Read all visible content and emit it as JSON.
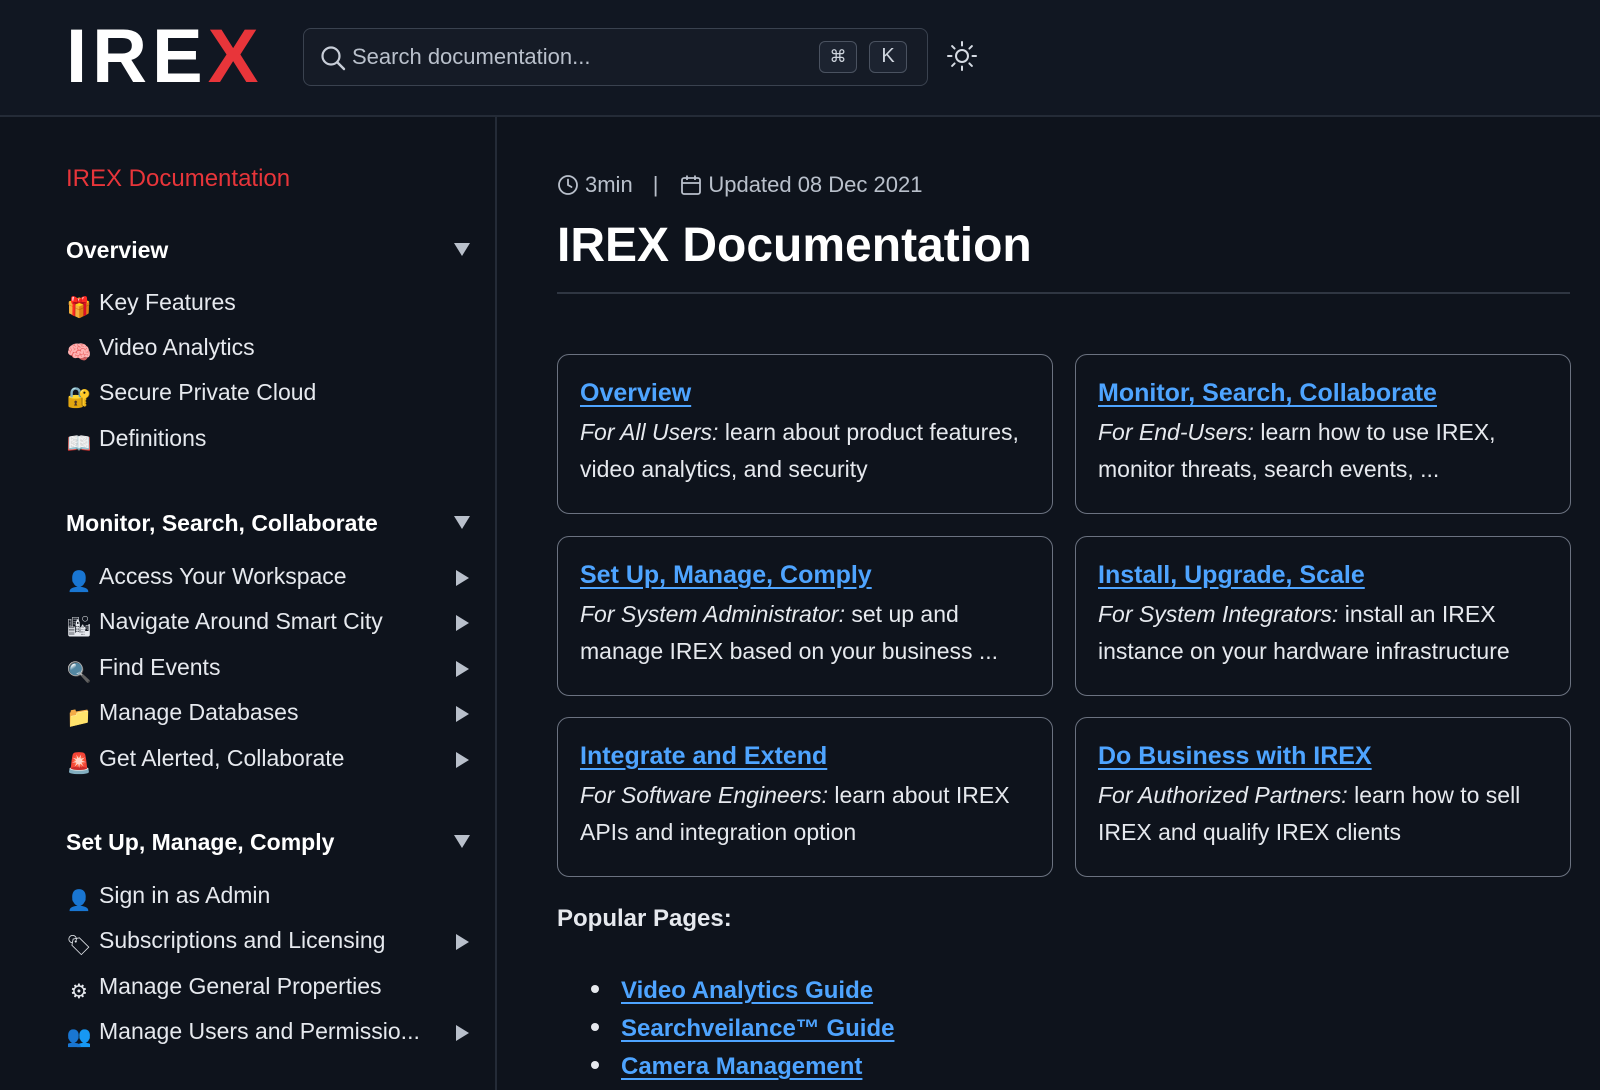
{
  "header": {
    "logo_text": "IRE",
    "logo_accent": "X",
    "search_placeholder": "Search documentation...",
    "shortcut_cmd": "⌘",
    "shortcut_key": "K",
    "theme_icon": "sun-icon"
  },
  "sidebar": {
    "title": "IREX Documentation",
    "sections": [
      {
        "label": "Overview",
        "items": [
          {
            "icon": "🎁",
            "label": "Key Features"
          },
          {
            "icon": "🧠",
            "label": "Video Analytics"
          },
          {
            "icon": "🔐",
            "label": "Secure Private Cloud"
          },
          {
            "icon": "📖",
            "label": "Definitions"
          }
        ]
      },
      {
        "label": "Monitor, Search, Collaborate",
        "items": [
          {
            "icon": "👤",
            "label": "Access Your Workspace"
          },
          {
            "icon": "🏙",
            "label": "Navigate Around Smart City"
          },
          {
            "icon": "🔍",
            "label": "Find Events"
          },
          {
            "icon": "📁",
            "label": "Manage Databases"
          },
          {
            "icon": "🚨",
            "label": "Get Alerted, Collaborate"
          }
        ]
      },
      {
        "label": "Set Up, Manage, Comply",
        "items": [
          {
            "icon": "👤",
            "label": "Sign in as Admin"
          },
          {
            "icon": "🏷",
            "label": "Subscriptions and Licensing"
          },
          {
            "icon": "⚙",
            "label": "Manage General Properties"
          },
          {
            "icon": "👥",
            "label": "Manage Users and Permissio..."
          }
        ]
      }
    ]
  },
  "main": {
    "read_time": "3min",
    "separator": "|",
    "updated": "Updated 08 Dec 2021",
    "title": "IREX Documentation",
    "cards": [
      {
        "title": "Overview",
        "audience": "For All Users:",
        "text": " learn about product features, video analytics, and security"
      },
      {
        "title": "Monitor, Search, Collaborate",
        "audience": "For End-Users:",
        "text": " learn how to use IREX, monitor threats, search events, ..."
      },
      {
        "title": "Set Up, Manage, Comply",
        "audience": "For System Administrator:",
        "text": " set up and manage IREX based on your business ..."
      },
      {
        "title": "Install, Upgrade, Scale",
        "audience": "For System Integrators:",
        "text": " install an IREX instance on your hardware infrastructure"
      },
      {
        "title": "Integrate and Extend",
        "audience": "For Software Engineers:",
        "text": " learn about IREX APIs and integration option"
      },
      {
        "title": "Do Business with IREX",
        "audience": "For Authorized Partners:",
        "text": " learn how to sell IREX and qualify IREX clients"
      }
    ],
    "popular_label": "Popular Pages:",
    "popular": [
      "Video Analytics Guide",
      "Searchveilance™ Guide",
      "Camera Management"
    ]
  },
  "colors": {
    "background": "#0e131c",
    "accent_red": "#e8353a",
    "link_blue": "#4ea4ff"
  }
}
